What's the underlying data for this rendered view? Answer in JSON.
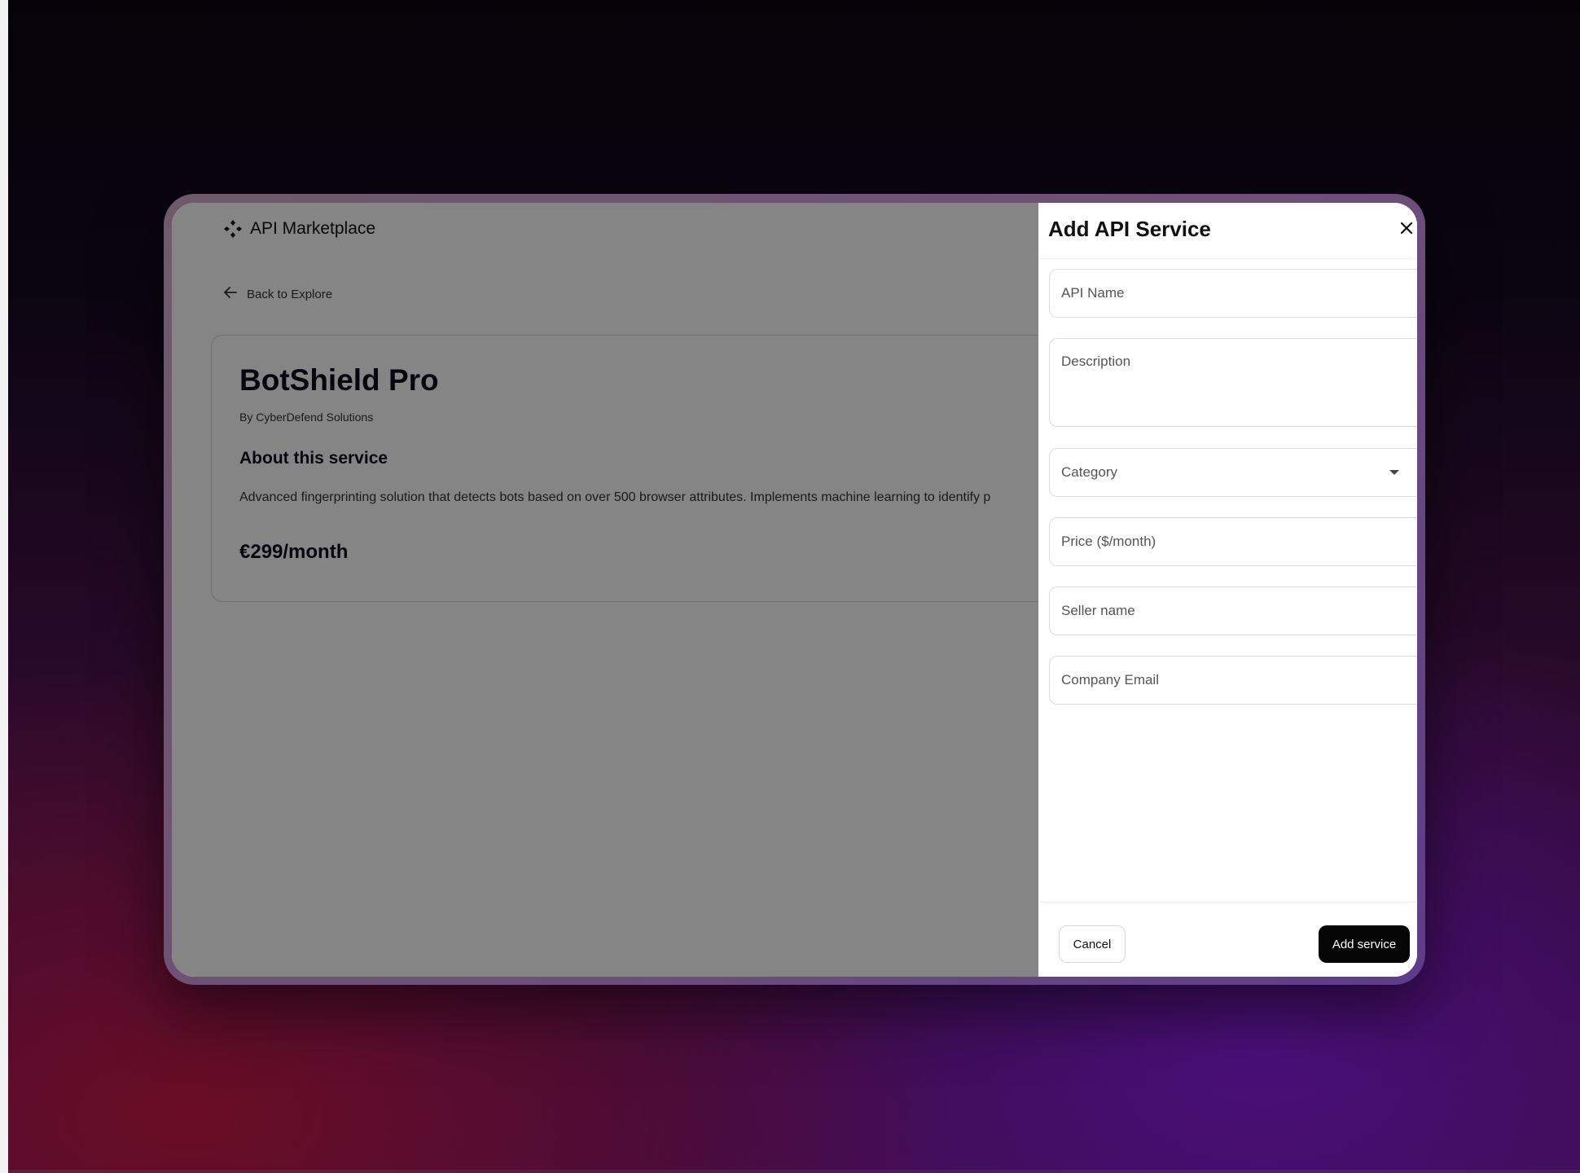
{
  "app": {
    "brand": "API Marketplace",
    "back_label": "Back to Explore"
  },
  "service": {
    "name": "BotShield Pro",
    "seller": "By CyberDefend Solutions",
    "about_heading": "About this service",
    "description": "Advanced fingerprinting solution that detects bots based on over 500 browser attributes. Implements machine learning to identify p",
    "price": "€299/month"
  },
  "drawer": {
    "title": "Add API Service",
    "fields": {
      "api_name_placeholder": "API Name",
      "description_placeholder": "Description",
      "category_placeholder": "Category",
      "price_placeholder": "Price ($/month)",
      "seller_placeholder": "Seller name",
      "email_placeholder": "Company Email"
    },
    "cancel_label": "Cancel",
    "submit_label": "Add service"
  },
  "icons": {
    "brand": "diamond-grid-icon",
    "back": "arrow-left-icon",
    "close": "close-icon",
    "category_caret": "chevron-down-icon"
  },
  "colors": {
    "primary_button": "#050505",
    "overlay": "rgba(0,0,0,0.48)",
    "heading_text": "#0d0d1e"
  }
}
